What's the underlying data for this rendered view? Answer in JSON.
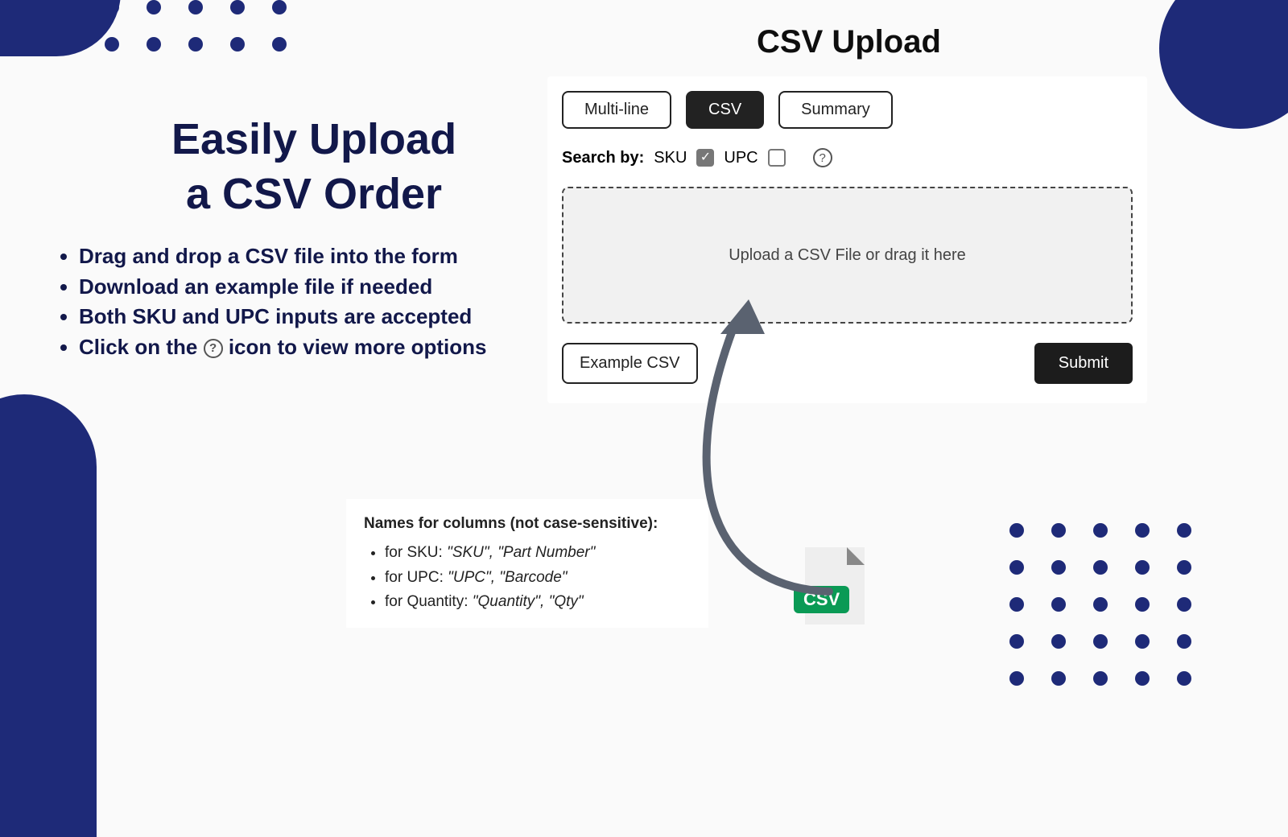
{
  "headline_line1": "Easily Upload",
  "headline_line2": "a CSV Order",
  "bullets": {
    "b1": "Drag and drop a CSV file into the form",
    "b2": "Download an example file if needed",
    "b3": "Both SKU and UPC inputs are accepted",
    "b4_a": "Click on the ",
    "b4_b": " icon to view more options"
  },
  "panel_title": "CSV Upload",
  "tabs": {
    "t1": "Multi-line",
    "t2": "CSV",
    "t3": "Summary"
  },
  "search": {
    "label": "Search by:",
    "opt1": "SKU",
    "opt2": "UPC"
  },
  "drop_text": "Upload a CSV File or drag it here",
  "example_btn": "Example CSV",
  "submit_btn": "Submit",
  "hint": {
    "title": "Names for columns (not case-sensitive)",
    "r1_a": "for SKU: ",
    "r1_b": "\"SKU\", \"Part Number\"",
    "r2_a": "for UPC: ",
    "r2_b": "\"UPC\", \"Barcode\"",
    "r3_a": "for Quantity: ",
    "r3_b": "\"Quantity\", \"Qty\""
  },
  "csv_badge": "CSV",
  "qmark": "?"
}
